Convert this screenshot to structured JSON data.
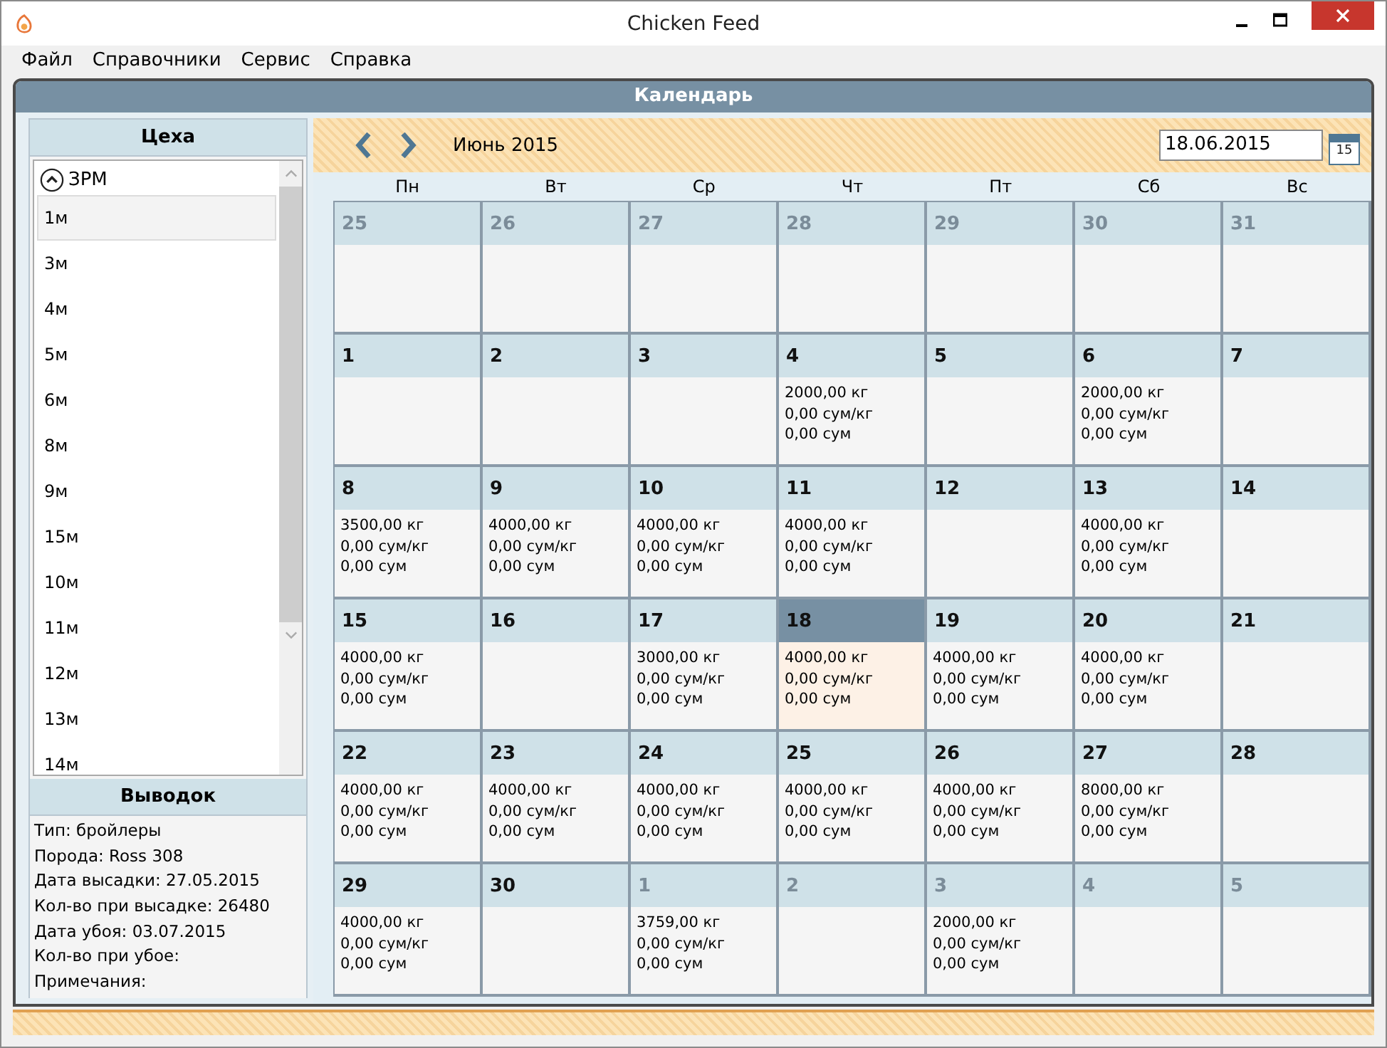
{
  "window": {
    "title": "Chicken Feed"
  },
  "menu": [
    "Файл",
    "Справочники",
    "Сервис",
    "Справка"
  ],
  "panel_title": "Календарь",
  "sidebar": {
    "title": "Цеха",
    "groups": [
      {
        "label": "ЗРМ",
        "expanded": true,
        "children": [
          {
            "label": "1м",
            "selected": true
          },
          {
            "label": "3м",
            "selected": false
          },
          {
            "label": "4м",
            "selected": false
          },
          {
            "label": "5м",
            "selected": false
          },
          {
            "label": "6м",
            "selected": false
          },
          {
            "label": "8м",
            "selected": false
          },
          {
            "label": "9м",
            "selected": false
          },
          {
            "label": "15м",
            "selected": false
          },
          {
            "label": "10м",
            "selected": false
          },
          {
            "label": "11м",
            "selected": false
          },
          {
            "label": "12м",
            "selected": false
          },
          {
            "label": "13м",
            "selected": false
          },
          {
            "label": "14м",
            "selected": false
          }
        ]
      }
    ]
  },
  "brood": {
    "title": "Выводок",
    "lines": [
      "Тип: бройлеры",
      "Порода: Ross 308",
      "Дата высадки: 27.05.2015",
      "Кол-во при высадке: 26480",
      "Дата убоя: 03.07.2015",
      "Кол-во при убое:",
      "Примечания:"
    ]
  },
  "toolbar": {
    "month": "Июнь 2015",
    "date": "18.06.2015",
    "calendar_day": "15"
  },
  "weekdays": [
    "Пн",
    "Вт",
    "Ср",
    "Чт",
    "Пт",
    "Сб",
    "Вс"
  ],
  "weeks": [
    [
      {
        "day": "25",
        "muted": true,
        "selected": false
      },
      {
        "day": "26",
        "muted": true,
        "selected": false
      },
      {
        "day": "27",
        "muted": true,
        "selected": false
      },
      {
        "day": "28",
        "muted": true,
        "selected": false
      },
      {
        "day": "29",
        "muted": true,
        "selected": false
      },
      {
        "day": "30",
        "muted": true,
        "selected": false
      },
      {
        "day": "31",
        "muted": true,
        "selected": false
      }
    ],
    [
      {
        "day": "1",
        "muted": false,
        "selected": false
      },
      {
        "day": "2",
        "muted": false,
        "selected": false
      },
      {
        "day": "3",
        "muted": false,
        "selected": false
      },
      {
        "day": "4",
        "muted": false,
        "selected": false,
        "lines": [
          "2000,00 кг",
          "0,00 сум/кг",
          "0,00 сум"
        ]
      },
      {
        "day": "5",
        "muted": false,
        "selected": false
      },
      {
        "day": "6",
        "muted": false,
        "selected": false,
        "lines": [
          "2000,00 кг",
          "0,00 сум/кг",
          "0,00 сум"
        ]
      },
      {
        "day": "7",
        "muted": false,
        "selected": false
      }
    ],
    [
      {
        "day": "8",
        "muted": false,
        "selected": false,
        "lines": [
          "3500,00 кг",
          "0,00 сум/кг",
          "0,00 сум"
        ]
      },
      {
        "day": "9",
        "muted": false,
        "selected": false,
        "lines": [
          "4000,00 кг",
          "0,00 сум/кг",
          "0,00 сум"
        ]
      },
      {
        "day": "10",
        "muted": false,
        "selected": false,
        "lines": [
          "4000,00 кг",
          "0,00 сум/кг",
          "0,00 сум"
        ]
      },
      {
        "day": "11",
        "muted": false,
        "selected": false,
        "lines": [
          "4000,00 кг",
          "0,00 сум/кг",
          "0,00 сум"
        ]
      },
      {
        "day": "12",
        "muted": false,
        "selected": false
      },
      {
        "day": "13",
        "muted": false,
        "selected": false,
        "lines": [
          "4000,00 кг",
          "0,00 сум/кг",
          "0,00 сум"
        ]
      },
      {
        "day": "14",
        "muted": false,
        "selected": false
      }
    ],
    [
      {
        "day": "15",
        "muted": false,
        "selected": false,
        "lines": [
          "4000,00 кг",
          "0,00 сум/кг",
          "0,00 сум"
        ]
      },
      {
        "day": "16",
        "muted": false,
        "selected": false
      },
      {
        "day": "17",
        "muted": false,
        "selected": false,
        "lines": [
          "3000,00 кг",
          "0,00 сум/кг",
          "0,00 сум"
        ]
      },
      {
        "day": "18",
        "muted": false,
        "selected": true,
        "lines": [
          "4000,00 кг",
          "0,00 сум/кг",
          "0,00 сум"
        ]
      },
      {
        "day": "19",
        "muted": false,
        "selected": false,
        "lines": [
          "4000,00 кг",
          "0,00 сум/кг",
          "0,00 сум"
        ]
      },
      {
        "day": "20",
        "muted": false,
        "selected": false,
        "lines": [
          "4000,00 кг",
          "0,00 сум/кг",
          "0,00 сум"
        ]
      },
      {
        "day": "21",
        "muted": false,
        "selected": false
      }
    ],
    [
      {
        "day": "22",
        "muted": false,
        "selected": false,
        "lines": [
          "4000,00 кг",
          "0,00 сум/кг",
          "0,00 сум"
        ]
      },
      {
        "day": "23",
        "muted": false,
        "selected": false,
        "lines": [
          "4000,00 кг",
          "0,00 сум/кг",
          "0,00 сум"
        ]
      },
      {
        "day": "24",
        "muted": false,
        "selected": false,
        "lines": [
          "4000,00 кг",
          "0,00 сум/кг",
          "0,00 сум"
        ]
      },
      {
        "day": "25",
        "muted": false,
        "selected": false,
        "lines": [
          "4000,00 кг",
          "0,00 сум/кг",
          "0,00 сум"
        ]
      },
      {
        "day": "26",
        "muted": false,
        "selected": false,
        "lines": [
          "4000,00 кг",
          "0,00 сум/кг",
          "0,00 сум"
        ]
      },
      {
        "day": "27",
        "muted": false,
        "selected": false,
        "lines": [
          "8000,00 кг",
          "0,00 сум/кг",
          "0,00 сум"
        ]
      },
      {
        "day": "28",
        "muted": false,
        "selected": false
      }
    ],
    [
      {
        "day": "29",
        "muted": false,
        "selected": false,
        "lines": [
          "4000,00 кг",
          "0,00 сум/кг",
          "0,00 сум"
        ]
      },
      {
        "day": "30",
        "muted": false,
        "selected": false
      },
      {
        "day": "1",
        "muted": true,
        "selected": false,
        "lines": [
          "3759,00 кг",
          "0,00 сум/кг",
          "0,00 сум"
        ]
      },
      {
        "day": "2",
        "muted": true,
        "selected": false
      },
      {
        "day": "3",
        "muted": true,
        "selected": false,
        "lines": [
          "2000,00 кг",
          "0,00 сум/кг",
          "0,00 сум"
        ]
      },
      {
        "day": "4",
        "muted": true,
        "selected": false
      },
      {
        "day": "5",
        "muted": true,
        "selected": false
      }
    ]
  ]
}
